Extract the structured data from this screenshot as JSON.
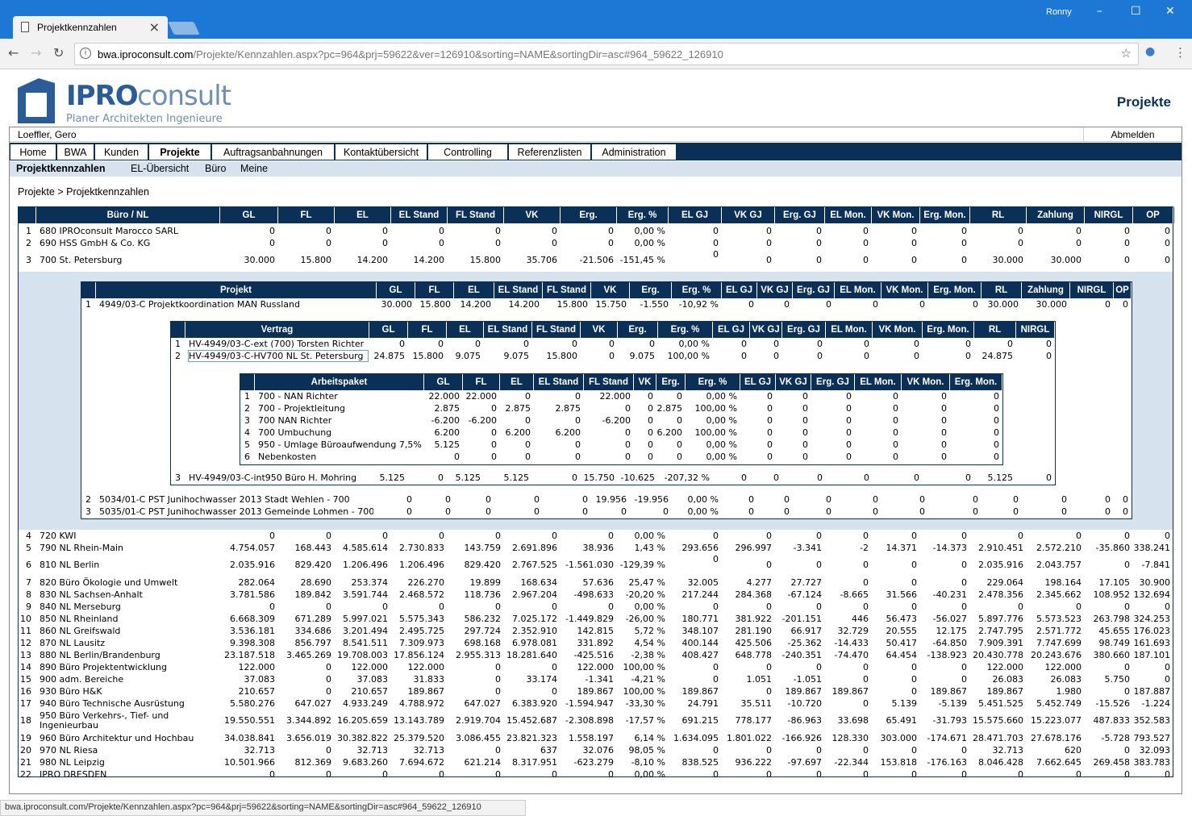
{
  "browser": {
    "tab_title": "Projektkennzahlen",
    "user": "Ronny",
    "url_host": "bwa.iproconsult.com",
    "url_path": "/Projekte/Kennzahlen.aspx?pc=964&prj=59622&ver=126910&sorting=NAME&sortingDir=asc#964_59622_126910",
    "status_url": "bwa.iproconsult.com/Projekte/Kennzahlen.aspx?pc=964&prj=59622&sorting=NAME&sortingDir=asc#964_59622_126910"
  },
  "logo": {
    "ipro": "IPRO",
    "consult": "consult",
    "tagline": "Planer  Architekten  Ingenieure"
  },
  "page_title": "Projekte",
  "user_name": "Loeffler, Gero",
  "logout": "Abmelden",
  "nav": [
    "Home",
    "BWA",
    "Kunden",
    "Projekte",
    "Auftragsanbahnungen",
    "Kontaktübersicht",
    "Controlling",
    "Referenzlisten",
    "Administration"
  ],
  "subnav": [
    "Projektkennzahlen",
    "EL-Übersicht",
    "Büro",
    "Meine"
  ],
  "breadcrumb": "Projekte > Projektkennzahlen",
  "main": {
    "headers": [
      "Büro / NL",
      "GL",
      "FL",
      "EL",
      "EL Stand",
      "FL Stand",
      "VK",
      "Erg.",
      "Erg. %",
      "EL GJ",
      "VK GJ",
      "Erg. GJ",
      "EL Mon.",
      "VK Mon.",
      "Erg. Mon.",
      "RL",
      "Zahlung",
      "NIRGL",
      "OP"
    ],
    "rows_top": [
      [
        "1",
        "680 IPROconsult Marocco SARL",
        "0",
        "0",
        "0",
        "0",
        "0",
        "0",
        "0",
        "0,00 %",
        "0",
        "0",
        "0",
        "0",
        "0",
        "0",
        "0",
        "0",
        "0",
        "0"
      ],
      [
        "2",
        "690 HSS GmbH & Co. KG",
        "0",
        "0",
        "0",
        "0",
        "0",
        "0",
        "0",
        "0,00 %",
        "0",
        "0",
        "0",
        "0",
        "0",
        "0",
        "0",
        "0",
        "0",
        "0"
      ],
      [
        "3",
        "700 St. Petersburg",
        "30.000",
        "15.800",
        "14.200",
        "14.200",
        "15.800",
        "35.706",
        "-21.506",
        "-151,45 %",
        "0",
        "0",
        "0",
        "0",
        "0",
        "0",
        "30.000",
        "30.000",
        "0",
        "0"
      ]
    ],
    "rows_bottom": [
      [
        "4",
        "720 KWI",
        "0",
        "0",
        "0",
        "0",
        "0",
        "0",
        "0",
        "0,00 %",
        "0",
        "0",
        "0",
        "0",
        "0",
        "0",
        "0",
        "0",
        "0",
        "0"
      ],
      [
        "5",
        "790 NL Rhein-Main",
        "4.754.057",
        "168.443",
        "4.585.614",
        "2.730.833",
        "143.759",
        "2.691.896",
        "38.936",
        "1,43 %",
        "293.656",
        "296.997",
        "-3.341",
        "-2",
        "14.371",
        "-14.373",
        "2.910.451",
        "2.572.210",
        "-35.860",
        "338.241"
      ],
      [
        "6",
        "810 NL Berlin",
        "2.035.916",
        "829.420",
        "1.206.496",
        "1.206.496",
        "829.420",
        "2.767.525",
        "-1.561.030",
        "-129,39 %",
        "0",
        "0",
        "0",
        "0",
        "0",
        "0",
        "2.035.916",
        "2.043.757",
        "0",
        "-7.841"
      ],
      [
        "7",
        "820 Büro Ökologie und Umwelt",
        "282.064",
        "28.690",
        "253.374",
        "226.270",
        "19.899",
        "168.634",
        "57.636",
        "25,47 %",
        "32.005",
        "4.277",
        "27.727",
        "0",
        "0",
        "0",
        "229.064",
        "198.164",
        "17.105",
        "30.900"
      ],
      [
        "8",
        "830 NL Sachsen-Anhalt",
        "3.781.586",
        "189.842",
        "3.591.744",
        "2.468.572",
        "118.736",
        "2.967.204",
        "-498.633",
        "-20,20 %",
        "217.244",
        "284.368",
        "-67.124",
        "-8.665",
        "31.566",
        "-40.231",
        "2.478.356",
        "2.345.662",
        "108.952",
        "132.694"
      ],
      [
        "9",
        "840 NL Merseburg",
        "0",
        "0",
        "0",
        "0",
        "0",
        "0",
        "0",
        "0,00 %",
        "0",
        "0",
        "0",
        "0",
        "0",
        "0",
        "0",
        "0",
        "0",
        "0"
      ],
      [
        "10",
        "850 NL Rheinland",
        "6.668.309",
        "671.289",
        "5.997.021",
        "5.575.343",
        "586.232",
        "7.025.172",
        "-1.449.829",
        "-26,00 %",
        "180.771",
        "381.922",
        "-201.151",
        "446",
        "56.473",
        "-56.027",
        "5.897.776",
        "5.573.523",
        "263.798",
        "324.253"
      ],
      [
        "11",
        "860 NL Greifswald",
        "3.536.181",
        "334.686",
        "3.201.494",
        "2.495.725",
        "297.724",
        "2.352.910",
        "142.815",
        "5,72 %",
        "348.107",
        "281.190",
        "66.917",
        "32.729",
        "20.555",
        "12.175",
        "2.747.795",
        "2.571.772",
        "45.655",
        "176.023"
      ],
      [
        "12",
        "870 NL Lausitz",
        "9.398.308",
        "856.797",
        "8.541.511",
        "7.309.973",
        "698.168",
        "6.978.081",
        "331.892",
        "4,54 %",
        "400.144",
        "425.506",
        "-25.362",
        "-14.433",
        "50.417",
        "-64.850",
        "7.909.391",
        "7.747.699",
        "98.749",
        "161.693"
      ],
      [
        "13",
        "880 NL Berlin/Brandenburg",
        "23.187.518",
        "3.465.269",
        "19.708.003",
        "17.856.124",
        "2.955.313",
        "18.281.640",
        "-425.516",
        "-2,38 %",
        "408.427",
        "648.778",
        "-240.351",
        "-74.470",
        "64.454",
        "-138.923",
        "20.430.778",
        "20.243.676",
        "380.660",
        "187.101"
      ],
      [
        "14",
        "890 Büro Projektentwicklung",
        "122.000",
        "0",
        "122.000",
        "122.000",
        "0",
        "0",
        "122.000",
        "100,00 %",
        "0",
        "0",
        "0",
        "0",
        "0",
        "0",
        "122.000",
        "122.000",
        "0",
        "0"
      ],
      [
        "15",
        "900 adm. Bereiche",
        "37.083",
        "0",
        "37.083",
        "31.833",
        "0",
        "33.174",
        "-1.341",
        "-4,21 %",
        "0",
        "1.051",
        "-1.051",
        "0",
        "0",
        "0",
        "26.083",
        "26.083",
        "5.750",
        "0"
      ],
      [
        "16",
        "930 Büro H&K",
        "210.657",
        "0",
        "210.657",
        "189.867",
        "0",
        "0",
        "189.867",
        "100,00 %",
        "189.867",
        "0",
        "189.867",
        "189.867",
        "0",
        "189.867",
        "189.867",
        "1.980",
        "0",
        "187.887"
      ],
      [
        "17",
        "940 Büro Technische Ausrüstung",
        "5.580.276",
        "647.027",
        "4.933.249",
        "4.788.972",
        "647.027",
        "6.383.920",
        "-1.594.947",
        "-33,30 %",
        "24.791",
        "35.511",
        "-10.720",
        "0",
        "5.139",
        "-5.139",
        "5.451.525",
        "5.452.749",
        "-15.526",
        "-1.224"
      ],
      [
        "18",
        "950 Büro Verkehrs-, Tief- und Ingenieurbau",
        "19.550.551",
        "3.344.892",
        "16.205.659",
        "13.143.789",
        "2.919.704",
        "15.452.687",
        "-2.308.898",
        "-17,57 %",
        "691.215",
        "778.177",
        "-86.963",
        "33.698",
        "65.491",
        "-31.793",
        "15.575.660",
        "15.223.077",
        "487.833",
        "352.583"
      ],
      [
        "19",
        "960 Büro Architektur und Hochbau",
        "34.038.841",
        "3.656.019",
        "30.382.822",
        "25.379.520",
        "3.086.455",
        "23.821.323",
        "1.558.197",
        "6,14 %",
        "1.634.095",
        "1.801.022",
        "-166.926",
        "128.330",
        "303.000",
        "-174.671",
        "28.471.703",
        "27.678.176",
        "-5.728",
        "793.527"
      ],
      [
        "20",
        "970 NL Riesa",
        "32.713",
        "0",
        "32.713",
        "32.713",
        "0",
        "637",
        "32.076",
        "98,05 %",
        "0",
        "0",
        "0",
        "0",
        "0",
        "0",
        "32.713",
        "620",
        "0",
        "32.093"
      ],
      [
        "21",
        "980 NL Leipzig",
        "10.501.966",
        "812.369",
        "9.683.260",
        "7.694.672",
        "621.214",
        "8.317.951",
        "-623.279",
        "-8,10 %",
        "838.525",
        "936.222",
        "-97.697",
        "-22.344",
        "153.818",
        "-176.163",
        "8.046.428",
        "7.662.645",
        "269.458",
        "383.783"
      ],
      [
        "22",
        "IPRO DRESDEN",
        "0",
        "0",
        "0",
        "0",
        "0",
        "0",
        "0",
        "0,00 %",
        "0",
        "0",
        "0",
        "0",
        "0",
        "0",
        "0",
        "0",
        "0",
        "0"
      ]
    ]
  },
  "projekt": {
    "headers": [
      "Projekt",
      "GL",
      "FL",
      "EL",
      "EL Stand",
      "FL Stand",
      "VK",
      "Erg.",
      "Erg. %",
      "EL GJ",
      "VK GJ",
      "Erg. GJ",
      "EL Mon.",
      "VK Mon.",
      "Erg. Mon.",
      "RL",
      "Zahlung",
      "NIRGL",
      "OP"
    ],
    "rows_top": [
      [
        "1",
        "4949/03-C Projektkoordination MAN Russland",
        "30.000",
        "15.800",
        "14.200",
        "14.200",
        "15.800",
        "15.750",
        "-1.550",
        "-10,92 %",
        "0",
        "0",
        "0",
        "0",
        "0",
        "0",
        "30.000",
        "30.000",
        "0",
        "0"
      ]
    ],
    "rows_bottom": [
      [
        "2",
        "5034/01-C PST Junihochwasser 2013 Stadt Wehlen - 700",
        "0",
        "0",
        "0",
        "0",
        "0",
        "19.956",
        "-19.956",
        "0,00 %",
        "0",
        "0",
        "0",
        "0",
        "0",
        "0",
        "0",
        "0",
        "0",
        "0"
      ],
      [
        "3",
        "5035/01-C PST Junihochwasser 2013 Gemeinde Lohmen - 700",
        "0",
        "0",
        "0",
        "0",
        "0",
        "0",
        "0",
        "0,00 %",
        "0",
        "0",
        "0",
        "0",
        "0",
        "0",
        "0",
        "0",
        "0",
        "0"
      ]
    ]
  },
  "vertrag": {
    "headers": [
      "Vertrag",
      "GL",
      "FL",
      "EL",
      "EL Stand",
      "FL Stand",
      "VK",
      "Erg.",
      "Erg. %",
      "EL GJ",
      "VK GJ",
      "Erg. GJ",
      "EL Mon.",
      "VK Mon.",
      "Erg. Mon.",
      "RL",
      "NIRGL"
    ],
    "rows_top": [
      [
        "1",
        "HV-4949/03-C-ext (700) Torsten Richter",
        "0",
        "0",
        "0",
        "0",
        "0",
        "0",
        "0",
        "0,00 %",
        "0",
        "0",
        "0",
        "0",
        "0",
        "0",
        "0",
        "0"
      ],
      [
        "2",
        "HV-4949/03-C-HV700 NL St. Petersburg",
        "24.875",
        "15.800",
        "9.075",
        "9.075",
        "15.800",
        "0",
        "9.075",
        "100,00 %",
        "0",
        "0",
        "0",
        "0",
        "0",
        "0",
        "24.875",
        "0"
      ]
    ],
    "rows_bottom": [
      [
        "3",
        "HV-4949/03-C-int950 Büro H. Mohring",
        "5.125",
        "0",
        "5.125",
        "5.125",
        "0",
        "15.750",
        "-10.625",
        "-207,32 %",
        "0",
        "0",
        "0",
        "0",
        "0",
        "0",
        "5.125",
        "0"
      ]
    ]
  },
  "arbeitspaket": {
    "headers": [
      "Arbeitspaket",
      "GL",
      "FL",
      "EL",
      "EL Stand",
      "FL Stand",
      "VK",
      "Erg.",
      "Erg. %",
      "EL GJ",
      "VK GJ",
      "Erg. GJ",
      "EL Mon.",
      "VK Mon.",
      "Erg. Mon."
    ],
    "rows": [
      [
        "1",
        "700 - NAN Richter",
        "22.000",
        "22.000",
        "0",
        "0",
        "22.000",
        "0",
        "0",
        "0,00 %",
        "0",
        "0",
        "0",
        "0",
        "0",
        "0"
      ],
      [
        "2",
        "700 - Projektleitung",
        "2.875",
        "0",
        "2.875",
        "2.875",
        "0",
        "0",
        "2.875",
        "100,00 %",
        "0",
        "0",
        "0",
        "0",
        "0",
        "0"
      ],
      [
        "3",
        "700 NAN Richter",
        "-6.200",
        "-6.200",
        "0",
        "0",
        "-6.200",
        "0",
        "0",
        "0,00 %",
        "0",
        "0",
        "0",
        "0",
        "0",
        "0"
      ],
      [
        "4",
        "700 Umbuchung",
        "6.200",
        "0",
        "6.200",
        "6.200",
        "0",
        "0",
        "6.200",
        "100,00 %",
        "0",
        "0",
        "0",
        "0",
        "0",
        "0"
      ],
      [
        "5",
        "950 - Umlage Büroaufwendung 7,5%",
        "5.125",
        "0",
        "0",
        "0",
        "0",
        "0",
        "0",
        "0,00 %",
        "0",
        "0",
        "0",
        "0",
        "0",
        "0"
      ],
      [
        "6",
        "Nebenkosten",
        "0",
        "0",
        "0",
        "0",
        "0",
        "0",
        "0",
        "0,00 %",
        "0",
        "0",
        "0",
        "0",
        "0",
        "0"
      ]
    ]
  }
}
